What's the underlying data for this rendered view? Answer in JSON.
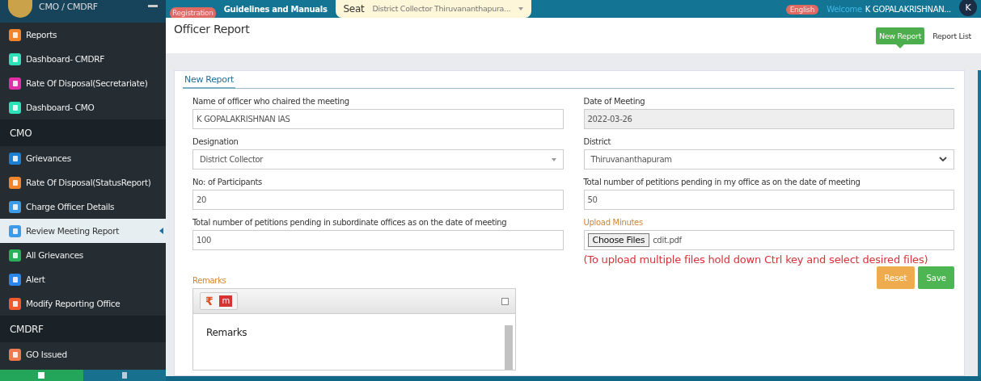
{
  "sidebar": {
    "brand": "CMO / CMDRF",
    "items": [
      {
        "kind": "item",
        "label": "Reports",
        "color": "#f0852d",
        "selected": false
      },
      {
        "kind": "item",
        "label": "Dashboard- CMDRF",
        "color": "#2ee0b8",
        "selected": false
      },
      {
        "kind": "item",
        "label": "Rate Of Disposal(Secretariate)",
        "color": "#e22fa8",
        "selected": false
      },
      {
        "kind": "item",
        "label": "Dashboard- CMO",
        "color": "#2ee0b8",
        "selected": false
      },
      {
        "kind": "section",
        "label": "CMO"
      },
      {
        "kind": "item",
        "label": "Grievances",
        "color": "#1c7fd0",
        "selected": false
      },
      {
        "kind": "item",
        "label": "Rate Of Disposal(StatusReport)",
        "color": "#f0852d",
        "selected": false
      },
      {
        "kind": "item",
        "label": "Charge Officer Details",
        "color": "#3a9be8",
        "selected": false
      },
      {
        "kind": "item",
        "label": "Review Meeting Report",
        "color": "#3a9be8",
        "selected": true
      },
      {
        "kind": "item",
        "label": "All Grievances",
        "color": "#2bb05a",
        "selected": false
      },
      {
        "kind": "item",
        "label": "Alert",
        "color": "#2a86e8",
        "selected": false
      },
      {
        "kind": "item",
        "label": "Modify Reporting Office",
        "color": "#f05a2d",
        "selected": false
      },
      {
        "kind": "section",
        "label": "CMDRF"
      },
      {
        "kind": "item",
        "label": "GO Issued",
        "color": "#f07a4d",
        "selected": false
      }
    ]
  },
  "topbar": {
    "registration": "Registration",
    "guidelines": "Guidelines and Manuals",
    "seat_label": "Seat",
    "seat_value": "District Collector Thiruvananthapura...",
    "language": "English",
    "welcome": "Welcome",
    "user": "K GOPALAKRISHNAN...",
    "avatar": "K"
  },
  "page": {
    "title": "Officer Report",
    "tabs": [
      {
        "label": "New Report",
        "selected": true
      },
      {
        "label": "Report List",
        "selected": false
      }
    ]
  },
  "form": {
    "tab": "New Report",
    "fields": [
      {
        "kind": "text",
        "label": "Name of officer who chaired the meeting",
        "value": "K GOPALAKRISHNAN IAS"
      },
      {
        "kind": "readonly",
        "label": "Date of Meeting",
        "value": "2022-03-26"
      },
      {
        "kind": "select",
        "label": "Designation",
        "value": "District Collector"
      },
      {
        "kind": "dropdown",
        "label": "District",
        "value": "Thiruvananthapuram"
      },
      {
        "kind": "text",
        "label": "No: of Participants",
        "value": "20"
      },
      {
        "kind": "text",
        "label": "Total number of petitions pending in my office as on the date of meeting",
        "value": "50"
      },
      {
        "kind": "text",
        "label": "Total number of petitions pending in subordinate offices as on the date of meeting",
        "value": "100"
      },
      {
        "kind": "file",
        "label": "Upload Minutes",
        "button": "Choose Files",
        "value": "cdit.pdf",
        "note": "(To upload multiple files hold down Ctrl key and select desired files)"
      }
    ],
    "remarks": {
      "label": "Remarks",
      "toolbar": [
        "₹",
        "m"
      ],
      "value": "Remarks"
    },
    "buttons": [
      {
        "kind": "reset",
        "label": "Reset"
      },
      {
        "kind": "save",
        "label": "Save"
      }
    ]
  }
}
